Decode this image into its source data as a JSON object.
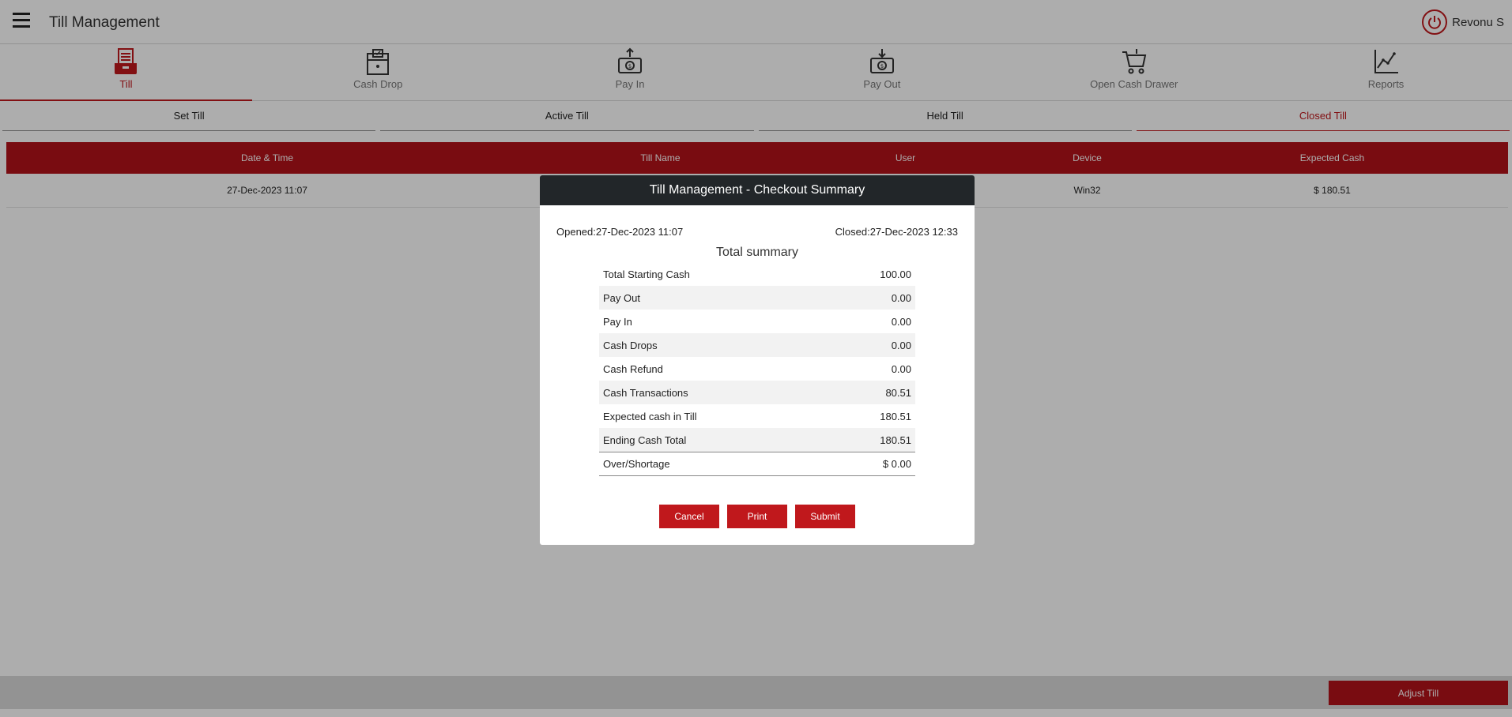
{
  "header": {
    "title": "Till Management",
    "user_name": "Revonu S"
  },
  "icon_tabs": [
    {
      "label": "Till",
      "icon": "till-icon"
    },
    {
      "label": "Cash Drop",
      "icon": "cash-drop-icon"
    },
    {
      "label": "Pay In",
      "icon": "pay-in-icon"
    },
    {
      "label": "Pay Out",
      "icon": "pay-out-icon"
    },
    {
      "label": "Open Cash Drawer",
      "icon": "cart-icon"
    },
    {
      "label": "Reports",
      "icon": "chart-icon"
    }
  ],
  "sub_tabs": [
    "Set Till",
    "Active Till",
    "Held Till",
    "Closed Till"
  ],
  "grid": {
    "columns": [
      "Date & Time",
      "Till Name",
      "User",
      "Device",
      "Expected Cash"
    ],
    "rows": [
      {
        "date": "27-Dec-2023 11:07",
        "till_name": "",
        "user": "",
        "device": "Win32",
        "expected": "$ 180.51"
      }
    ]
  },
  "footer": {
    "adjust_label": "Adjust Till"
  },
  "modal": {
    "title": "Till Management - Checkout Summary",
    "opened": "Opened:27-Dec-2023 11:07",
    "closed": "Closed:27-Dec-2023 12:33",
    "subtitle": "Total summary",
    "rows": [
      {
        "label": "Total Starting Cash",
        "value": "100.00"
      },
      {
        "label": "Pay Out",
        "value": "0.00"
      },
      {
        "label": "Pay In",
        "value": "0.00"
      },
      {
        "label": "Cash Drops",
        "value": "0.00"
      },
      {
        "label": "Cash Refund",
        "value": "0.00"
      },
      {
        "label": "Cash Transactions",
        "value": "80.51"
      },
      {
        "label": "Expected cash in Till",
        "value": "180.51"
      },
      {
        "label": "Ending Cash Total",
        "value": "180.51"
      }
    ],
    "total": {
      "label": "Over/Shortage",
      "value": "$ 0.00"
    },
    "buttons": {
      "cancel": "Cancel",
      "print": "Print",
      "submit": "Submit"
    }
  },
  "colors": {
    "accent": "#c0181c",
    "header_red": "#b3131a",
    "modal_header": "#222629"
  }
}
